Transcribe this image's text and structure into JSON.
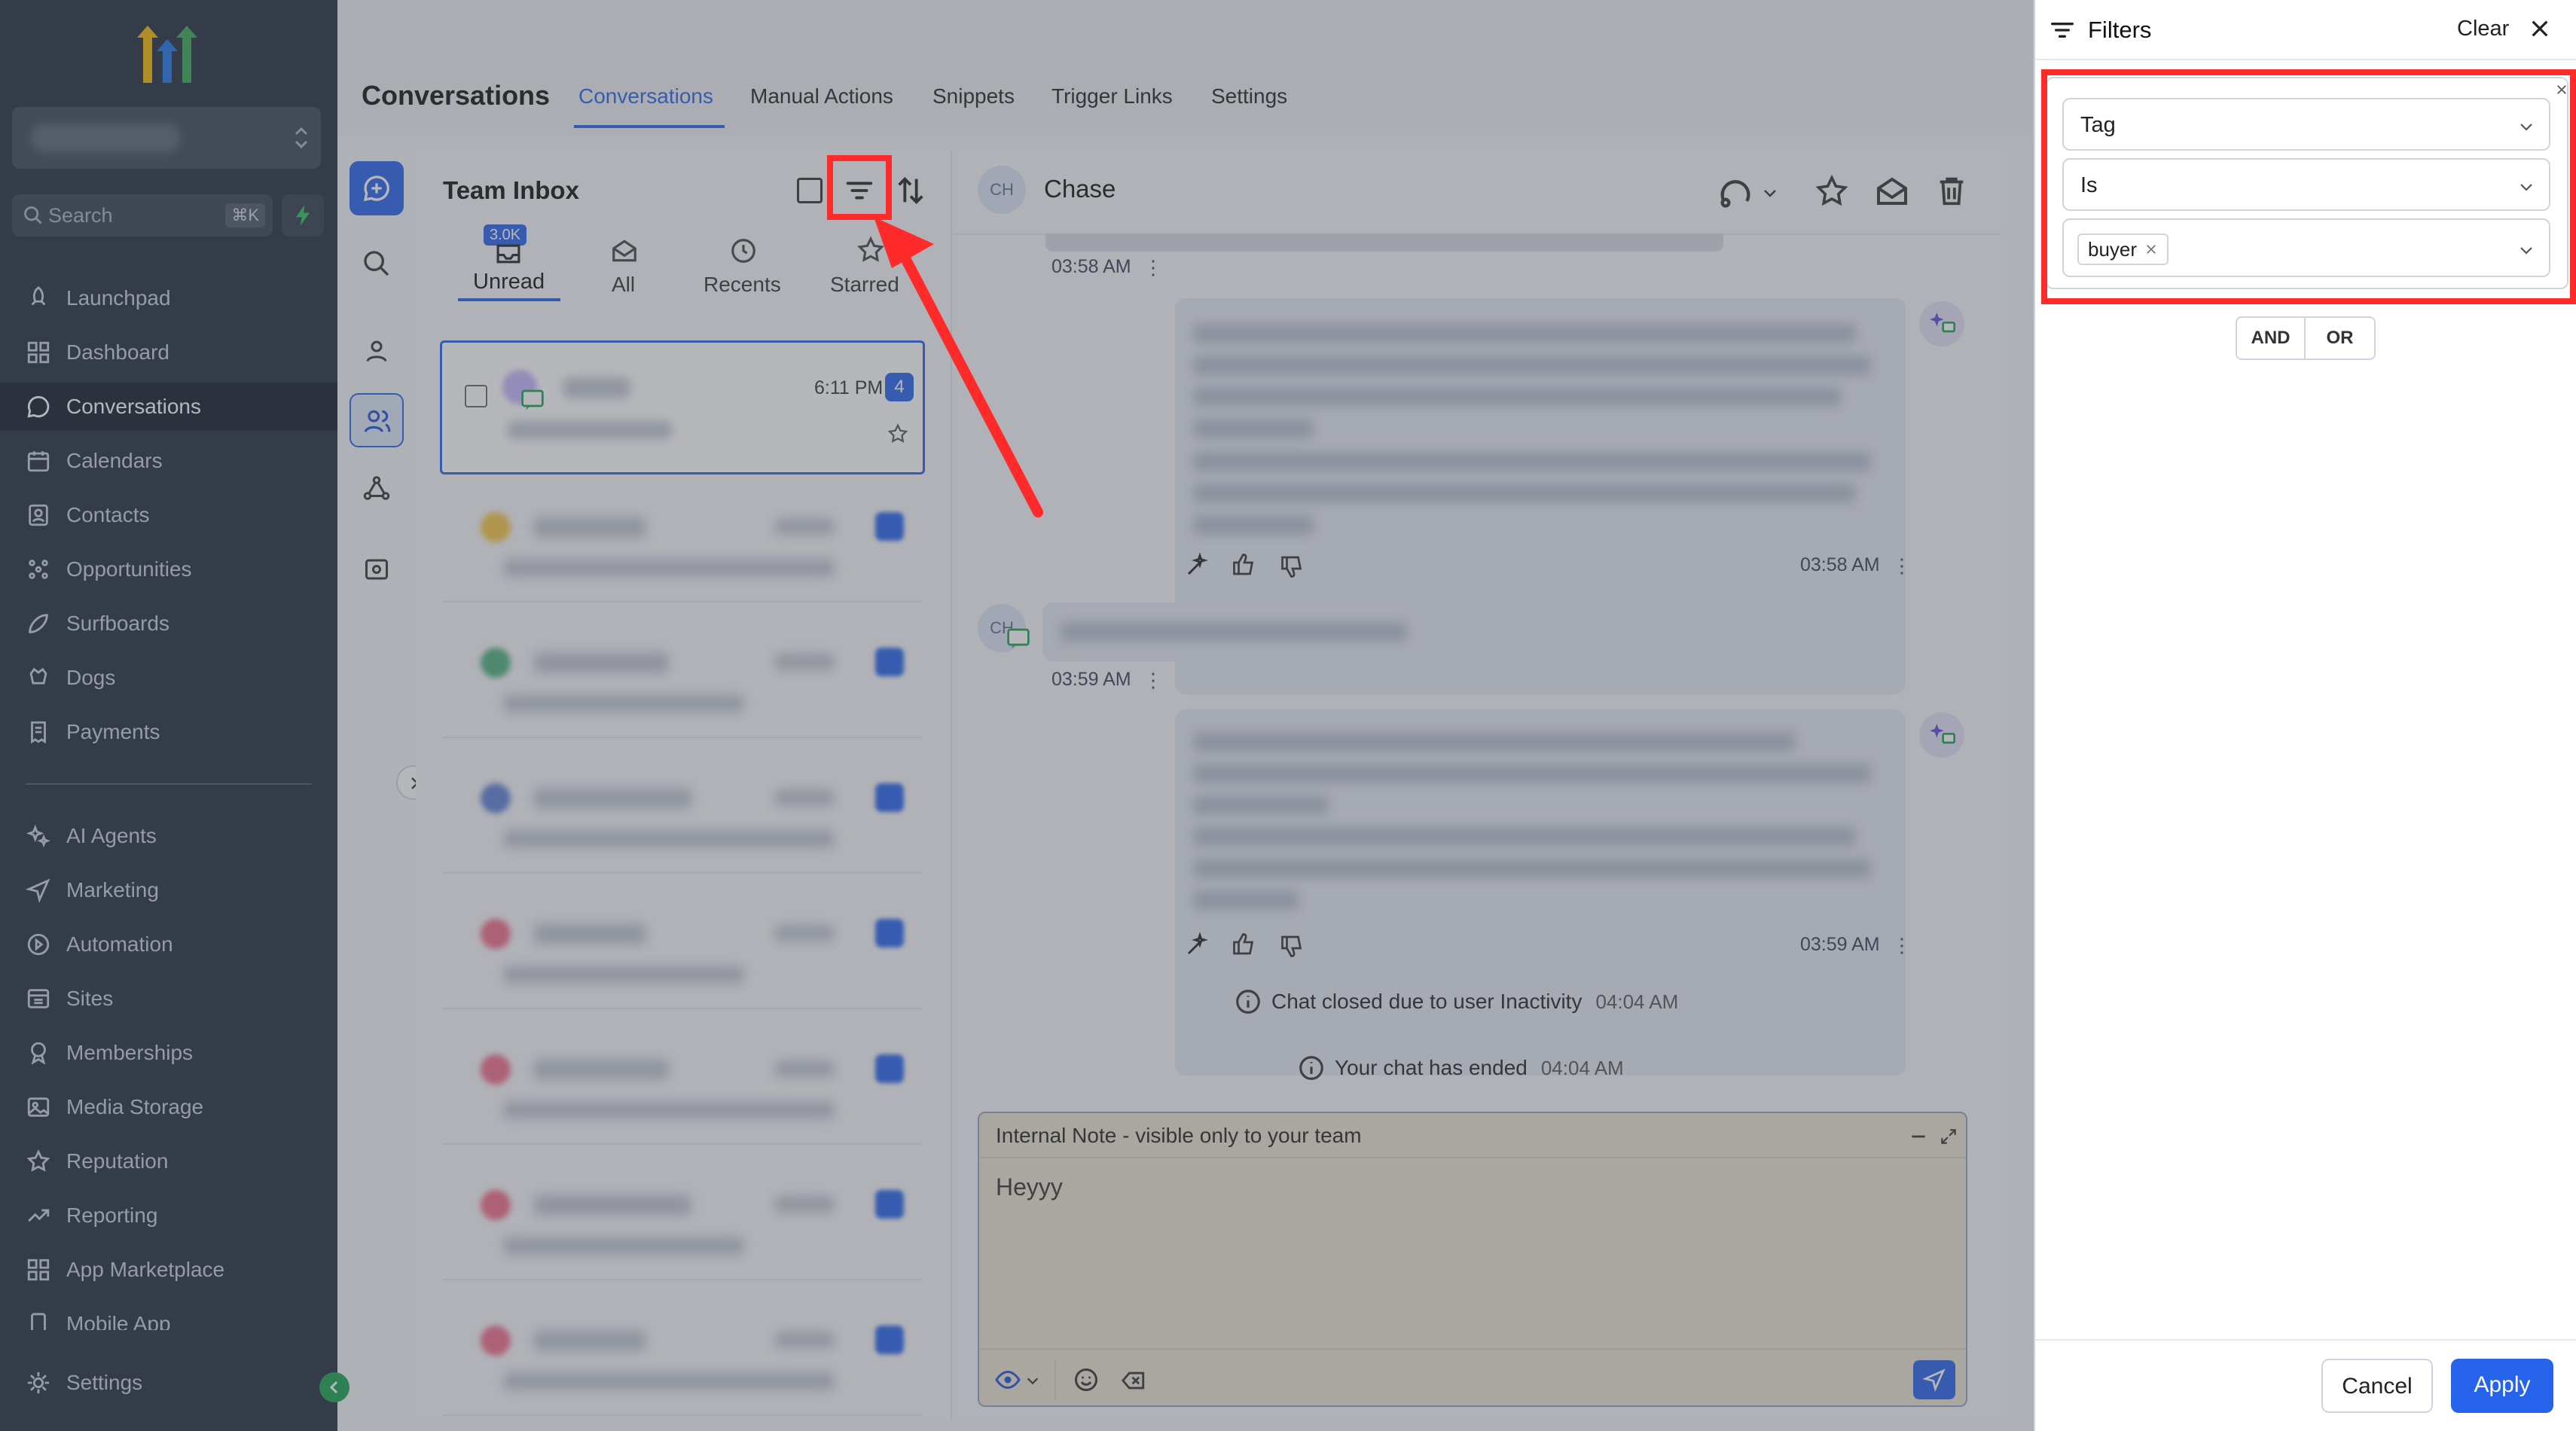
{
  "sidebar": {
    "search_placeholder": "Search",
    "search_shortcut": "⌘K",
    "items_top": [
      {
        "label": "Launchpad",
        "icon": "rocket-icon"
      },
      {
        "label": "Dashboard",
        "icon": "grid-icon"
      },
      {
        "label": "Conversations",
        "icon": "chat-icon",
        "active": true
      },
      {
        "label": "Calendars",
        "icon": "calendar-icon"
      },
      {
        "label": "Contacts",
        "icon": "contacts-icon"
      },
      {
        "label": "Opportunities",
        "icon": "funnel-icon"
      },
      {
        "label": "Surfboards",
        "icon": "surfboard-icon"
      },
      {
        "label": "Dogs",
        "icon": "dog-icon"
      },
      {
        "label": "Payments",
        "icon": "receipt-icon"
      }
    ],
    "items_bottom": [
      {
        "label": "AI Agents",
        "icon": "sparkle-icon"
      },
      {
        "label": "Marketing",
        "icon": "send-icon"
      },
      {
        "label": "Automation",
        "icon": "automation-icon"
      },
      {
        "label": "Sites",
        "icon": "sites-icon"
      },
      {
        "label": "Memberships",
        "icon": "award-icon"
      },
      {
        "label": "Media Storage",
        "icon": "image-icon"
      },
      {
        "label": "Reputation",
        "icon": "star-icon"
      },
      {
        "label": "Reporting",
        "icon": "trend-icon"
      },
      {
        "label": "App Marketplace",
        "icon": "apps-icon"
      },
      {
        "label": "Mobile App",
        "icon": "phone-icon"
      }
    ],
    "settings_label": "Settings"
  },
  "header": {
    "title": "Conversations",
    "tabs": [
      "Conversations",
      "Manual Actions",
      "Snippets",
      "Trigger Links",
      "Settings"
    ],
    "active_tab": "Conversations"
  },
  "inbox": {
    "title": "Team Inbox",
    "tabs": [
      {
        "label": "Unread",
        "badge": "3.0K"
      },
      {
        "label": "All"
      },
      {
        "label": "Recents"
      },
      {
        "label": "Starred"
      }
    ],
    "first_item": {
      "time": "6:11 PM",
      "count": "4"
    }
  },
  "chat": {
    "avatar": "CH",
    "contact_name": "Chase",
    "times": [
      "03:58 AM",
      "03:58 AM",
      "03:59 AM",
      "03:59 AM"
    ],
    "system_1": "Chat closed due to user Inactivity",
    "system_1_time": "04:04 AM",
    "system_2": "Your chat has ended",
    "system_2_time": "04:04 AM",
    "note_title": "Internal Note - visible only to your team",
    "note_text": "Heyyy"
  },
  "filters": {
    "title": "Filters",
    "clear": "Clear",
    "field": "Tag",
    "operator": "Is",
    "tag_value": "buyer",
    "and": "AND",
    "or": "OR",
    "cancel": "Cancel",
    "apply": "Apply"
  },
  "colors": {
    "sidebar_bg": "#1f2a3c",
    "accent": "#2563eb",
    "highlight": "#ff2b2b",
    "note_bg": "#e9e4cf"
  }
}
